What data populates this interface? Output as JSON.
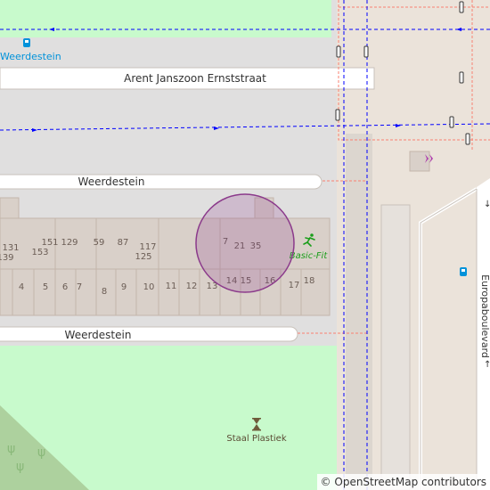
{
  "map": {
    "streets": {
      "arent": "Arent Janszoon Ernststraat",
      "weerdestein_top": "Weerdestein",
      "weerdestein_bottom": "Weerdestein",
      "europaboulevard": "Europaboulevard"
    },
    "pois": {
      "bus_stop_label": "Weerdestein",
      "gym_label": "Basic-Fit",
      "artwork_label": "Staal Plastiek"
    },
    "house_numbers_upper": [
      "131",
      "139",
      "153",
      "151",
      "129",
      "59",
      "87",
      "117",
      "125",
      "7",
      "21",
      "35"
    ],
    "house_numbers_lower": [
      "4",
      "5",
      "6",
      "7",
      "8",
      "9",
      "10",
      "11",
      "12",
      "13",
      "14",
      "15",
      "16",
      "17",
      "18"
    ],
    "icons": [
      "bus-stop-icon",
      "traffic-signal-icon",
      "fitness-icon",
      "shop-icon",
      "artwork-icon",
      "tree-icon"
    ],
    "colors": {
      "background": "#e0dfdf",
      "park": "#c8facc",
      "building": "#d9d0c9",
      "building_outline": "#c4b6ab",
      "footway": "#fa8072",
      "cycleway": "#0000ff",
      "highlight_circle": "#8b3a8b",
      "gym_green": "#1a9e1a",
      "bus_blue": "#0092da",
      "shop_magenta": "#ac39ac"
    }
  },
  "attribution": {
    "symbol": "©",
    "text": "OpenStreetMap contributors"
  }
}
